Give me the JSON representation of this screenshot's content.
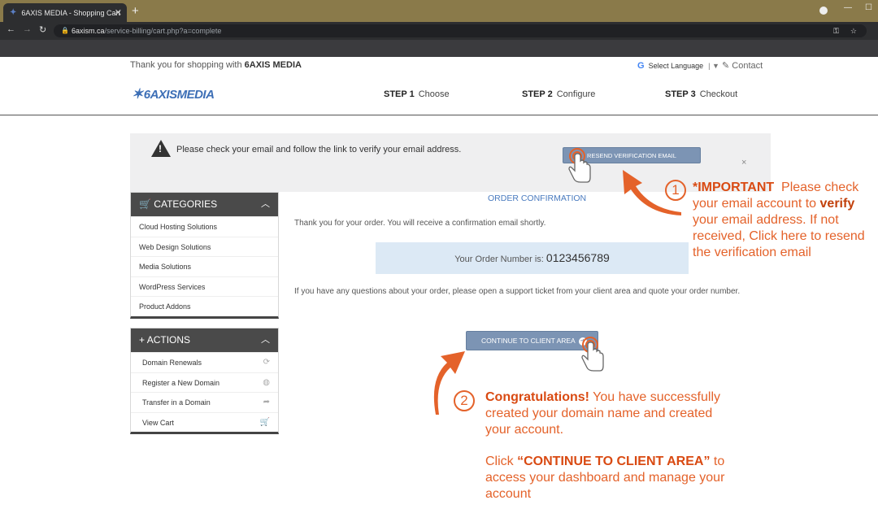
{
  "browser": {
    "tab_title": "6AXIS MEDIA - Shopping Cart",
    "url_domain": "6axism.ca",
    "url_path": "/service-billing/cart.php?a=complete"
  },
  "header": {
    "thanks_prefix": "Thank you for shopping with",
    "brand": "6AXIS MEDIA",
    "select_language": "Select Language",
    "contact": "Contact",
    "logo_text": "6AXISMEDIA",
    "steps": [
      {
        "num": "STEP 1",
        "label": "Choose"
      },
      {
        "num": "STEP 2",
        "label": "Configure"
      },
      {
        "num": "STEP 3",
        "label": "Checkout"
      }
    ]
  },
  "alert": {
    "text": "Please check your email and follow the link to verify your email address.",
    "button": "RESEND VERIFICATION EMAIL",
    "close": "×"
  },
  "sidebar": {
    "categories_title": "CATEGORIES",
    "categories": [
      "Cloud Hosting Solutions",
      "Web Design Solutions",
      "Media Solutions",
      "WordPress Services",
      "Product Addons"
    ],
    "actions_title": "ACTIONS",
    "actions": [
      "Domain Renewals",
      "Register a New Domain",
      "Transfer in a Domain",
      "View Cart"
    ]
  },
  "main": {
    "title": "ORDER CONFIRMATION",
    "thanks": "Thank you for your order. You will receive a confirmation email shortly.",
    "order_label": "Your Order Number is:",
    "order_number": "0123456789",
    "questions": "If you have any questions about your order, please open a support ticket from your client area and quote your order number.",
    "continue_button": "CONTINUE TO CLIENT AREA"
  },
  "annotations": {
    "one": "1",
    "two": "2",
    "important_head": "*IMPORTANT",
    "important_a": "Please check your email account to",
    "important_verify": "verify",
    "important_b": "your email address. If not received, Click here to resend the verification email",
    "congrats_head": "Congratulations!",
    "congrats_rest": "You have successfully created your domain name and created your account.",
    "click_prefix": "Click",
    "click_quote": "“CONTINUE TO CLIENT AREA”",
    "click_rest": "to access your dashboard and manage your account"
  },
  "colors": {
    "accent": "#e4622a",
    "button": "#7c94b4",
    "panel_head": "#4a4a4a"
  }
}
